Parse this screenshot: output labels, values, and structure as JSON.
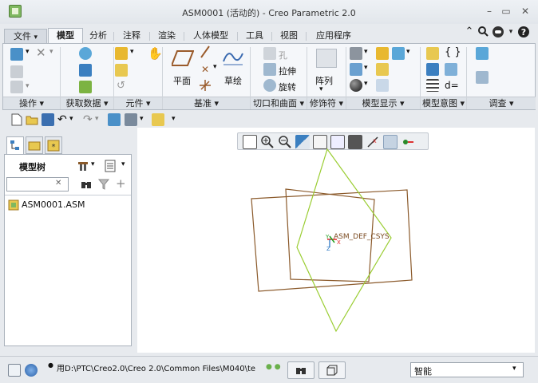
{
  "window": {
    "title": "ASM0001 (活动的) - Creo Parametric 2.0",
    "minimize": "–",
    "restore": "▭",
    "close": "✕"
  },
  "tabs": [
    {
      "label": "文件"
    },
    {
      "label": "模型"
    },
    {
      "label": "分析"
    },
    {
      "label": "注释"
    },
    {
      "label": "渲染"
    },
    {
      "label": "人体模型"
    },
    {
      "label": "工具"
    },
    {
      "label": "视图"
    },
    {
      "label": "应用程序"
    }
  ],
  "file_arrow": "▾",
  "ribbon": {
    "groups": [
      {
        "label": "操作 ▾"
      },
      {
        "label": "获取数据 ▾"
      },
      {
        "label": "元件 ▾"
      },
      {
        "label": "基准 ▾"
      },
      {
        "label": "切口和曲面 ▾"
      },
      {
        "label": "修饰符 ▾"
      },
      {
        "label": "模型显示 ▾"
      },
      {
        "label": "模型意图 ▾"
      },
      {
        "label": "调查 ▾"
      }
    ],
    "datum": {
      "plane": "平面",
      "sketch": "草绘"
    },
    "cut": {
      "hole": "孔",
      "extrude": "拉伸",
      "revolve": "旋转"
    },
    "modifier": {
      "pattern": "阵列"
    }
  },
  "left_panel": {
    "tree_title": "模型树",
    "search_placeholder": "",
    "clear": "✕",
    "items": [
      {
        "label": "ASM0001.ASM"
      }
    ]
  },
  "graphics": {
    "csys_label": "ASM_DEF_CSYS",
    "axis_x": "X",
    "axis_y": "Y",
    "axis_z": "Z",
    "colors": {
      "plane_brown": "#8b5a2b",
      "plane_green": "#9acd32",
      "csys_red": "#e32222",
      "csys_green": "#20a020"
    }
  },
  "statusbar": {
    "message": "用D:\\PTC\\Creo2.0\\Creo 2.0\\Common Files\\M040\\te",
    "filter_value": "智能"
  }
}
